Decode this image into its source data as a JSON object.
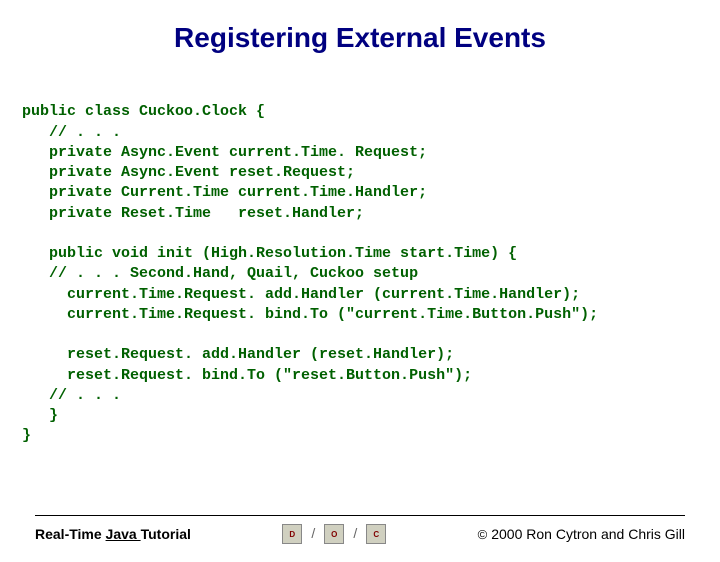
{
  "title": "Registering External Events",
  "code": {
    "l1": "public class Cuckoo.Clock {",
    "l2": "   // . . .",
    "l3": "   private Async.Event current.Time. Request;",
    "l4": "   private Async.Event reset.Request;",
    "l5": "   private Current.Time current.Time.Handler;",
    "l6": "   private Reset.Time   reset.Handler;",
    "l7": "",
    "l8": "   public void init (High.Resolution.Time start.Time) {",
    "l9": "   // . . . Second.Hand, Quail, Cuckoo setup",
    "l10": "     current.Time.Request. add.Handler (current.Time.Handler);",
    "l11": "     current.Time.Request. bind.To (\"current.Time.Button.Push\");",
    "l12": "",
    "l13": "     reset.Request. add.Handler (reset.Handler);",
    "l14": "     reset.Request. bind.To (\"reset.Button.Push\");",
    "l15": "   // . . .",
    "l16": "   }",
    "l17": "}"
  },
  "footer": {
    "left_prefix": "Real-Time ",
    "left_underline": "Java ",
    "left_suffix": "Tutorial",
    "logo": [
      "D",
      "O",
      "C"
    ],
    "copyright": "2000 Ron Cytron and Chris Gill"
  }
}
